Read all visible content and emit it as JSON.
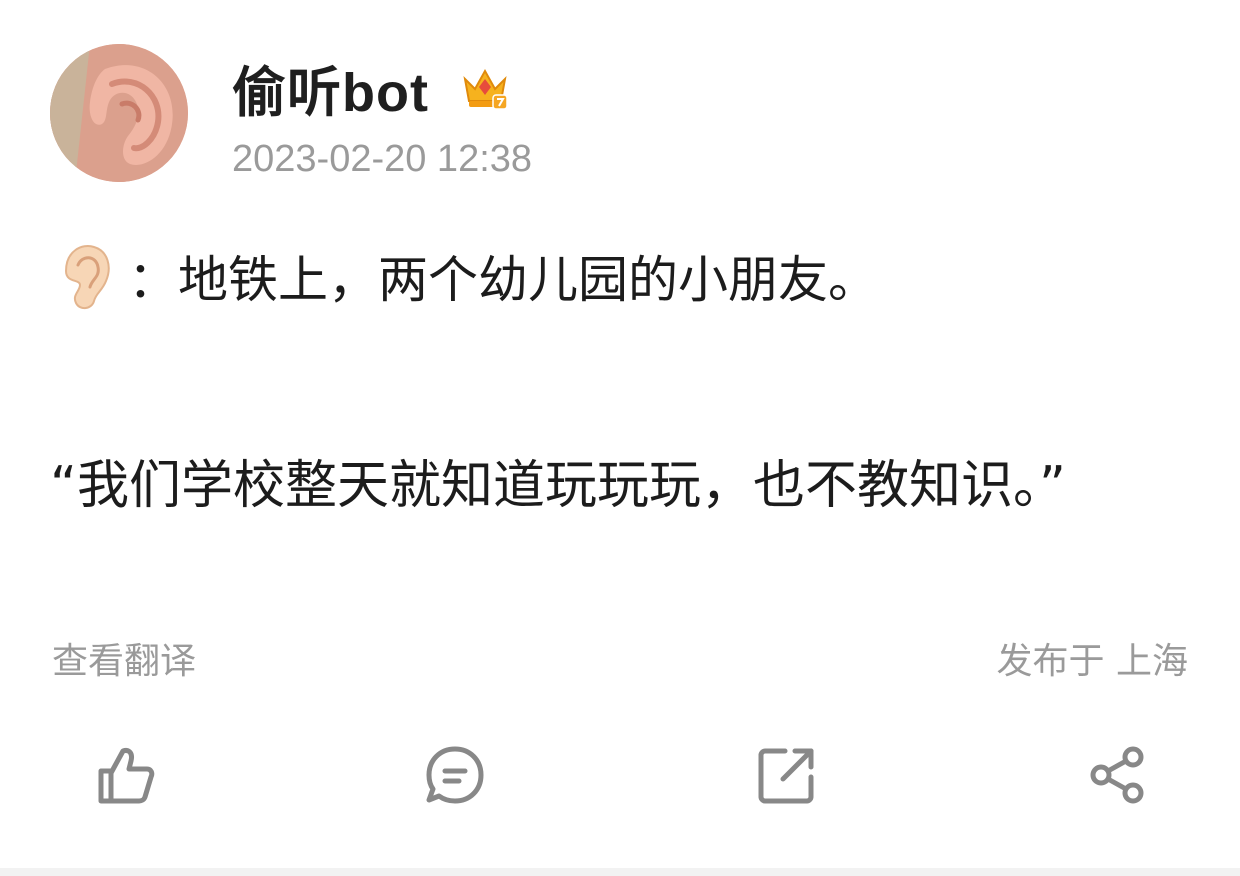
{
  "post": {
    "author": "偷听bot",
    "timestamp": "2023-02-20 12:38",
    "line1": "：地铁上，两个幼儿园的小朋友。",
    "line2": "“我们学校整天就知道玩玩玩，也不教知识。”",
    "translate_label": "查看翻译",
    "location": "发布于 上海"
  },
  "icons": {
    "avatar": "ear-avatar",
    "badge": "crown-icon",
    "emoji": "ear-emoji-icon",
    "like": "thumbs-up-icon",
    "comment": "comment-icon",
    "repost": "repost-icon",
    "share": "share-icon"
  },
  "colors": {
    "text": "#1c1c1c",
    "muted": "#9a9a9a",
    "icon": "#888888"
  }
}
